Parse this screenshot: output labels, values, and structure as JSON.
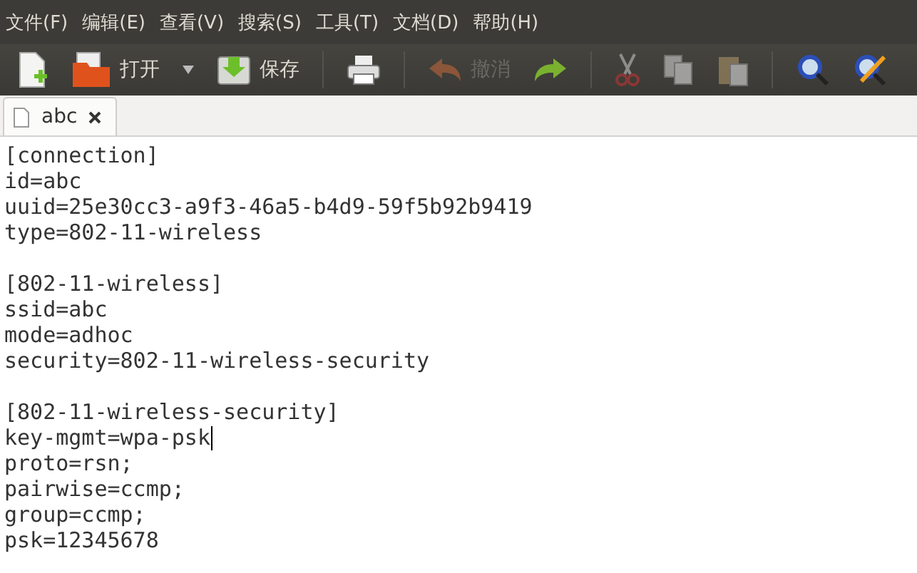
{
  "menu_bar": [
    "文件(F)",
    "编辑(E)",
    "查看(V)",
    "搜索(S)",
    "工具(T)",
    "文档(D)",
    "帮助(H)"
  ],
  "toolbar": [
    {
      "kind": "button",
      "disabled": false
    },
    {
      "kind": "button",
      "label": "打开",
      "disabled": false
    },
    {
      "kind": "dropdown",
      "disabled": false
    },
    {
      "kind": "button",
      "label": "保存",
      "disabled": false
    },
    {
      "kind": "separator"
    },
    {
      "kind": "button",
      "disabled": false
    },
    {
      "kind": "separator"
    },
    {
      "kind": "button",
      "label": "撤消",
      "disabled": true
    },
    {
      "kind": "button",
      "disabled": false
    },
    {
      "kind": "separator"
    },
    {
      "kind": "button",
      "disabled": true
    },
    {
      "kind": "button",
      "disabled": true
    },
    {
      "kind": "button",
      "disabled": true
    },
    {
      "kind": "separator"
    },
    {
      "kind": "button",
      "disabled": false
    },
    {
      "kind": "button",
      "disabled": false
    }
  ],
  "tabs": [
    {
      "label": "abc",
      "selected": true
    }
  ],
  "editor": {
    "lines": [
      {
        "text": "[connection]",
        "cursor": false
      },
      {
        "text": "id=abc",
        "cursor": false
      },
      {
        "text": "uuid=25e30cc3-a9f3-46a5-b4d9-59f5b92b9419",
        "cursor": false
      },
      {
        "text": "type=802-11-wireless",
        "cursor": false
      },
      {
        "cursor": false
      },
      {
        "text": "[802-11-wireless]",
        "cursor": false
      },
      {
        "text": "ssid=abc",
        "cursor": false
      },
      {
        "text": "mode=adhoc",
        "cursor": false
      },
      {
        "text": "security=802-11-wireless-security",
        "cursor": false
      },
      {
        "cursor": false
      },
      {
        "text": "[802-11-wireless-security]",
        "cursor": false
      },
      {
        "text": "key-mgmt=wpa-psk",
        "cursor": true
      },
      {
        "text": "proto=rsn;",
        "cursor": false
      },
      {
        "text": "pairwise=ccmp;",
        "cursor": false
      },
      {
        "text": "group=ccmp;",
        "cursor": false
      },
      {
        "text": "psk=12345678",
        "cursor": false
      }
    ]
  }
}
